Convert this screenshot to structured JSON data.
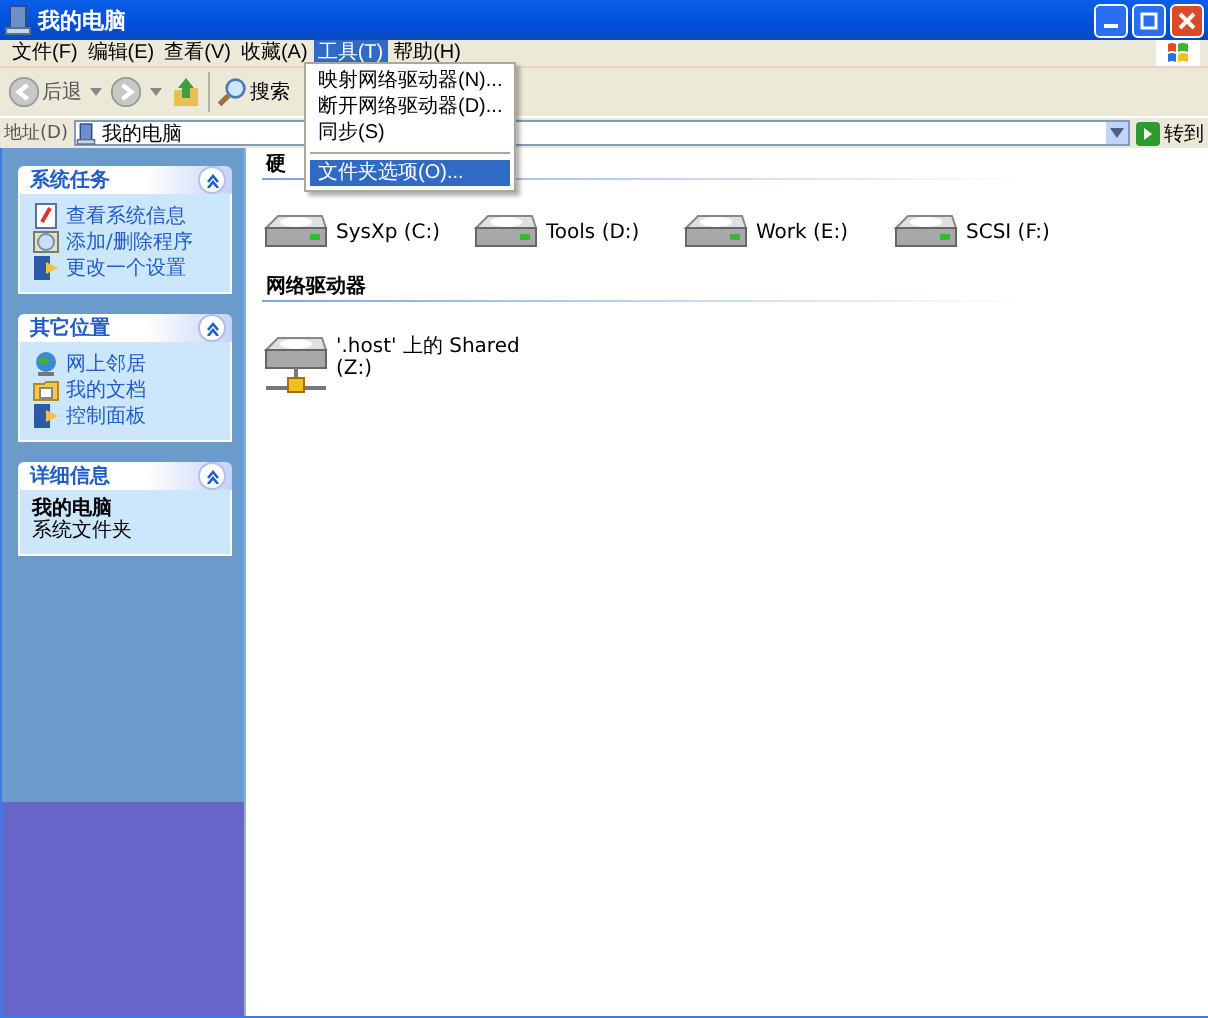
{
  "window": {
    "title": "我的电脑"
  },
  "menu_bar": [
    {
      "label": "文件(F)",
      "selected": false
    },
    {
      "label": "编辑(E)",
      "selected": false
    },
    {
      "label": "查看(V)",
      "selected": false
    },
    {
      "label": "收藏(A)",
      "selected": false
    },
    {
      "label": "工具(T)",
      "selected": true
    },
    {
      "label": "帮助(H)",
      "selected": false
    }
  ],
  "open_menu": [
    {
      "kind": "item",
      "label": "映射网络驱动器(N)...",
      "selected": false
    },
    {
      "kind": "item",
      "label": "断开网络驱动器(D)...",
      "selected": false
    },
    {
      "kind": "item",
      "label": "同步(S)",
      "selected": false
    },
    {
      "kind": "separator"
    },
    {
      "kind": "item",
      "label": "文件夹选项(O)...",
      "selected": true
    }
  ],
  "toolbar": {
    "back": "后退",
    "search": "搜索"
  },
  "address_bar": {
    "label": "地址(D)",
    "value": "我的电脑",
    "go": "转到"
  },
  "sidebar": [
    {
      "kind": "links",
      "title": "系统任务",
      "items": [
        "查看系统信息",
        "添加/删除程序",
        "更改一个设置"
      ]
    },
    {
      "kind": "links",
      "title": "其它位置",
      "items": [
        "网上邻居",
        "我的文档",
        "控制面板"
      ]
    },
    {
      "kind": "details",
      "title": "详细信息",
      "name": "我的电脑",
      "description": "系统文件夹"
    }
  ],
  "sections": [
    {
      "title": "硬",
      "items": [
        {
          "kind": "disk",
          "label": "SysXp (C:)"
        },
        {
          "kind": "disk",
          "label": "Tools (D:)"
        },
        {
          "kind": "disk",
          "label": "Work (E:)"
        },
        {
          "kind": "disk",
          "label": "SCSI (F:)"
        }
      ]
    },
    {
      "title": "网络驱动器",
      "items": [
        {
          "kind": "network",
          "label": "'.host' 上的 Shared",
          "sublabel": "(Z:)"
        }
      ]
    }
  ]
}
